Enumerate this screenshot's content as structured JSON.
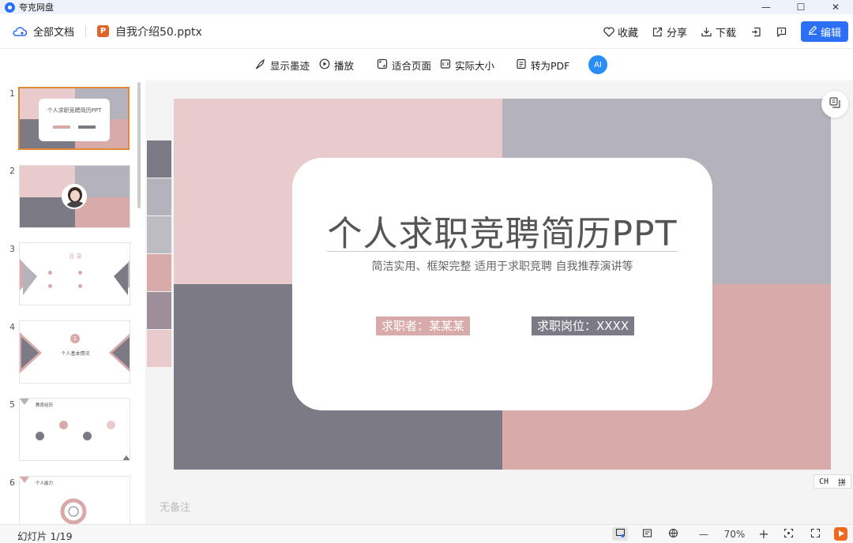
{
  "app": {
    "name": "夸克网盘"
  },
  "window": {
    "minimize": "—",
    "maximize": "☐",
    "close": "✕"
  },
  "toolbar": {
    "all_docs": "全部文档",
    "filename": "自我介绍50.pptx",
    "ppt_badge": "P",
    "collect": "收藏",
    "share": "分享",
    "download": "下载",
    "edit": "编辑"
  },
  "viewbar": {
    "ink": "显示墨迹",
    "play": "播放",
    "fit": "适合页面",
    "actual": "实际大小",
    "to_pdf": "转为PDF",
    "ai": "AI"
  },
  "thumbnails": [
    {
      "num": "1"
    },
    {
      "num": "2"
    },
    {
      "num": "3"
    },
    {
      "num": "4"
    },
    {
      "num": "5"
    },
    {
      "num": "6"
    }
  ],
  "thumb_text": {
    "t1_title": "个人求职竞聘简历PPT",
    "t3_title": "目 录",
    "t4_num": "1",
    "t4_title": "个人基本情况",
    "t5_title": "教育经历",
    "t6_title": "个人能力"
  },
  "slide": {
    "title": "个人求职竞聘简历PPT",
    "subtitle": "简洁实用、框架完整 适用于求职竞聘 自我推荐演讲等",
    "tag_applicant": "求职者：某某某",
    "tag_position": "求职岗位：XXXX"
  },
  "colors": {
    "pink": "#e9cbcd",
    "grey_light": "#b4b2ba",
    "grey_dark": "#7b7a85",
    "rose": "#d9aaaa",
    "accent": "#2a6ff6"
  },
  "notes": {
    "placeholder": "无备注"
  },
  "ime": {
    "ch": "CH",
    "mode": "拼"
  },
  "status": {
    "page": "幻灯片 1/19",
    "zoom_minus": "—",
    "zoom": "70%",
    "zoom_plus": "+"
  }
}
